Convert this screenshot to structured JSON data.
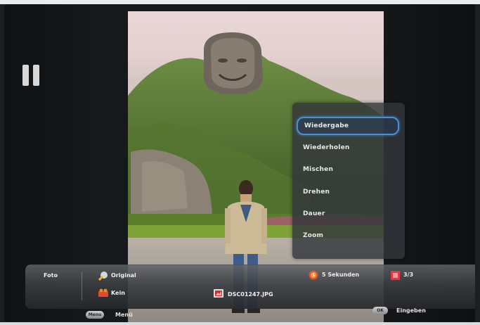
{
  "slideshow": {
    "status": "paused",
    "status_icon": "pause-icon"
  },
  "photo": {
    "description_colors": {
      "sky": "#e6d3d4",
      "foliage": "#5f7f3a",
      "rock": "#8a8175"
    }
  },
  "menu": {
    "items": [
      {
        "label": "Wiedergabe",
        "active": true
      },
      {
        "label": "Wiederholen",
        "active": false
      },
      {
        "label": "Mischen",
        "active": false
      },
      {
        "label": "Drehen",
        "active": false
      },
      {
        "label": "Dauer",
        "active": false
      },
      {
        "label": "Zoom",
        "active": false
      }
    ],
    "highlight_color": "#4d8fd6"
  },
  "info_bar": {
    "category": "Foto",
    "effect": "Original",
    "effect_icon": "effect-icon",
    "music": "Kein",
    "music_icon": "music-icon",
    "filename": "DSC01247.JPG",
    "file_icon": "photo-file-icon",
    "interval": "5 Sekunden",
    "interval_icon": "timer-icon",
    "position": "3/3",
    "position_icon": "slides-icon"
  },
  "hints": {
    "menu_button": "Menu",
    "menu_label": "Menü",
    "ok_button": "OK",
    "ok_label": "Eingeben"
  }
}
